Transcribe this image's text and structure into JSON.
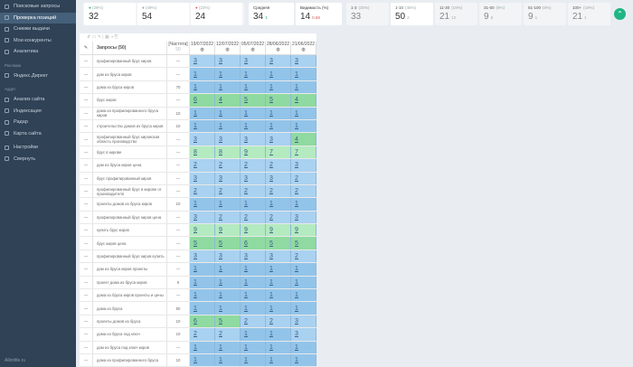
{
  "sidebar": {
    "items": [
      "Поисковые запросы",
      "Проверка позиций",
      "Снимки выдачи",
      "Мои конкуренты",
      "Аналитика"
    ],
    "section_ads": "Реклама",
    "ads_items": [
      "Яндекс.Директ"
    ],
    "section_audit": "Аудит",
    "audit_items": [
      "Анализ сайта",
      "Индексация",
      "Радар",
      "Карта сайта"
    ],
    "bottom_items": [
      "Настройки",
      "Свернуть"
    ],
    "footer": "Allintitle.ru"
  },
  "stats": [
    {
      "label": "(29%)",
      "value": "32",
      "color": "#1fb585"
    },
    {
      "label": "(49%)",
      "value": "54",
      "color": "#999"
    },
    {
      "label": "(22%)",
      "value": "24",
      "color": "#e05555"
    }
  ],
  "avg": {
    "label": "Средняя",
    "value": "34",
    "delta": "1"
  },
  "visibility": {
    "label": "Видимость (%)",
    "value": "14",
    "delta": "0.69"
  },
  "ranges": [
    {
      "label": "1-3",
      "pct": "(30%)",
      "value": "33",
      "delta": ""
    },
    {
      "label": "1-10",
      "pct": "(45%)",
      "value": "50",
      "delta": "2"
    },
    {
      "label": "11-30",
      "pct": "(19%)",
      "value": "21",
      "delta": "12"
    },
    {
      "label": "31-50",
      "pct": "(8%)",
      "value": "9",
      "delta": "8"
    },
    {
      "label": "51-100",
      "pct": "(8%)",
      "value": "9",
      "delta": "1"
    },
    {
      "label": "100+",
      "pct": "(19%)",
      "value": "21",
      "delta": "1"
    }
  ],
  "table": {
    "query_header": "Запросы (50)",
    "freq_header": "[Частота]",
    "freq_sub": "50",
    "dates": [
      "19/07/2022",
      "12/07/2022",
      "05/07/2022",
      "28/06/2022",
      "21/06/2022"
    ],
    "rows": [
      [
        "профилированный брус киров",
        "—",
        [
          3,
          3,
          3,
          3,
          3
        ]
      ],
      [
        "дом из бруса киров",
        "—",
        [
          1,
          1,
          1,
          1,
          1
        ]
      ],
      [
        "дома из бруса киров",
        "70",
        [
          1,
          1,
          1,
          1,
          1
        ]
      ],
      [
        "брус киров",
        "—",
        [
          6,
          4,
          5,
          5,
          4
        ]
      ],
      [
        "дома из профилированного бруса киров",
        "10",
        [
          1,
          1,
          1,
          1,
          1
        ]
      ],
      [
        "строительство домов из бруса киров",
        "10",
        [
          1,
          1,
          1,
          1,
          1
        ]
      ],
      [
        "профилированный брус кировская область производство",
        "—",
        [
          3,
          3,
          3,
          3,
          4
        ]
      ],
      [
        "брус в кирове",
        "—",
        [
          8,
          8,
          9,
          7,
          7
        ]
      ],
      [
        "дом из бруса киров цена",
        "—",
        [
          2,
          2,
          2,
          2,
          3
        ]
      ],
      [
        "брус профилированный киров",
        "—",
        [
          3,
          3,
          3,
          3,
          2
        ]
      ],
      [
        "профилированный брус в кирове от производителя",
        "—",
        [
          2,
          2,
          2,
          2,
          2
        ]
      ],
      [
        "проекты домов из бруса киров",
        "10",
        [
          1,
          1,
          1,
          1,
          1
        ]
      ],
      [
        "профилированный брус киров цена",
        "—",
        [
          3,
          2,
          2,
          2,
          3
        ]
      ],
      [
        "купить брус киров",
        "—",
        [
          9,
          9,
          9,
          9,
          9
        ]
      ],
      [
        "брус киров цена",
        "—",
        [
          5,
          5,
          6,
          5,
          5
        ]
      ],
      [
        "профилированный брус киров купить",
        "—",
        [
          3,
          3,
          3,
          3,
          2
        ]
      ],
      [
        "дом из бруса киров проекты",
        "—",
        [
          1,
          1,
          1,
          1,
          1
        ]
      ],
      [
        "проект дома из бруса киров",
        "0",
        [
          1,
          1,
          1,
          1,
          1
        ]
      ],
      [
        "дома из бруса киров проекты и цены",
        "—",
        [
          1,
          1,
          1,
          1,
          1
        ]
      ],
      [
        "дома из бруса",
        "50",
        [
          1,
          1,
          1,
          1,
          1
        ]
      ],
      [
        "проекты домов из бруса",
        "10",
        [
          6,
          5,
          2,
          2,
          3
        ]
      ],
      [
        "дома из бруса под ключ",
        "10",
        [
          2,
          2,
          1,
          1,
          3
        ]
      ],
      [
        "дом из бруса под ключ киров",
        "—",
        [
          1,
          1,
          1,
          1,
          1
        ]
      ],
      [
        "дома из профилированного бруса",
        "10",
        [
          1,
          1,
          1,
          1,
          1
        ]
      ]
    ]
  }
}
